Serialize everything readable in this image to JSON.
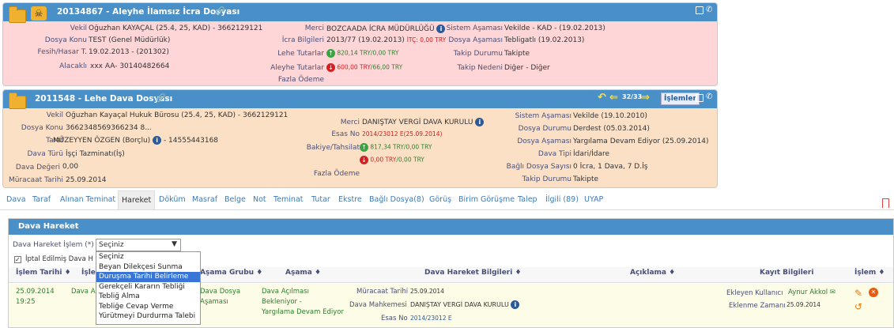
{
  "panel1": {
    "title": "20134867 - Aleyhe İlamsız İcra Dosyası",
    "vekil_l": "Vekil",
    "vekil_v": "Oğuzhan KAYAÇAL (25.4, 25, KAD) - 3662129121",
    "dkonu_l": "Dosya Konu",
    "dkonu_v": "TEST (Genel Müdürlük)",
    "fesih_l": "Fesih/Hasar T.",
    "fesih_v": "19.02.2013 - (201302)",
    "alacak_l": "Alacaklı",
    "alacak_v": "xxx AA- 30140482664",
    "merci_l": "Merci",
    "merci_v": "BOZCAADA İCRA MÜDÜRLÜĞÜ",
    "icra_l": "İcra Bilgileri",
    "icra_v": "2013/77 (19.02.2013)",
    "itc": "İTÇ: 0,00 TRY",
    "lehe_l": "Lehe Tutarlar",
    "lehe_v1": "820,14 TRY",
    "lehe_v2": "/0,00 TRY",
    "aleyhe_l": "Aleyhe Tutarlar",
    "aleyhe_v1": "600,00 TRY",
    "aleyhe_v2": "/66,00 TRY",
    "fazla_l": "Fazla Ödeme",
    "sistem_l": "Sistem Aşaması",
    "sistem_v": "Vekilde - KAD - (19.02.2013)",
    "dasama_l": "Dosya Aşaması",
    "dasama_v": "Tebligatlı (19.02.2013)",
    "tdurum_l": "Takip Durumu",
    "tdurum_v": "Takipte",
    "tneden_l": "Takip Nedeni",
    "tneden_v": "Diğer - Diğer"
  },
  "panel2": {
    "title": "2011548 - Lehe Dava Dosyası",
    "pager": "32/33",
    "islemler": "İşlemler",
    "vekil_l": "Vekil",
    "vekil_v": "Oğuzhan Kayaçal Hukuk Bürosu (25.4, 25, KAD) - 3662129121",
    "dkonu_l": "Dosya Konu",
    "dkonu_v": "3662348569366234 8...",
    "taraf_l": "Taraf",
    "taraf_v": "MÜZEYYEN ÖZGEN (Borçlu)",
    "taraf_v2": "- 14555443168",
    "dturu_l": "Dava Türü",
    "dturu_v": "İşçi Tazminatı(İş)",
    "ddeger_l": "Dava Değeri",
    "ddeger_v": "0,00",
    "mtarih_l": "Müracaat Tarihi",
    "mtarih_v": "25.09.2014",
    "merci_l": "Merci",
    "merci_v": "DANIŞTAY VERGİ DAVA KURULU",
    "esas_l": "Esas No",
    "esas_v": "2014/23012 E(25.09.2014)",
    "bakiye_l": "Bakiye/Tahsilat",
    "bakiye_v1": "817,34 TRY",
    "bakiye_v2": "/0,00 TRY",
    "bakiye_v3": "0,00 TRY",
    "bakiye_v4": "/0,00 TRY",
    "fazla_l": "Fazla Ödeme",
    "sistem_l": "Sistem Aşaması",
    "sistem_v": "Vekilde (19.10.2010)",
    "ddurum_l": "Dosya Durumu",
    "ddurum_v": "Derdest (05.03.2014)",
    "dasama_l": "Dosya Aşaması",
    "dasama_v": "Yargılama Devam Ediyor (25.09.2014)",
    "dtipi_l": "Dava Tipi",
    "dtipi_v": "İdari/İdare",
    "bagli_l": "Bağlı Dosya Sayısı",
    "bagli_v": "0 İcra, 1 Dava, 7 D.İş",
    "tdurum_l": "Takip Durumu",
    "tdurum_v": "Takipte"
  },
  "tabs": [
    "Dava",
    "Taraf",
    "Alınan Teminat",
    "Hareket",
    "Döküm",
    "Masraf",
    "Belge",
    "Not",
    "Teminat",
    "Tutar",
    "Ekstre",
    "Bağlı Dosya(8)",
    "Görüş",
    "Birim Görüşme",
    "Talep",
    "İlgili (89)",
    "UYAP"
  ],
  "section": {
    "title": "Dava Hareket",
    "islem_label": "Dava Hareket İşlem (*)",
    "select_value": "Seçiniz",
    "checkbox_label": "İptal Edilmiş Dava H",
    "options": [
      "Seçiniz",
      "Beyan Dilekçesi Sunma",
      "Duruşma Tarihi Belirleme",
      "Gerekçeli Kararın Tebliği",
      "Tebliğ Alma",
      "Tebliğe Cevap Verme",
      "Yürütmeyi Durdurma Talebi"
    ],
    "columns": {
      "tarih": "İşlem Tarihi ♦",
      "islem": "İşle",
      "grup": "Aşama Grubu ♦",
      "asama": "Aşama ♦",
      "bilgi": "Dava Hareket Bilgileri ♦",
      "aciklama": "Açıklama ♦",
      "kayit": "Kayıt Bilgileri",
      "islem2": "İşlem ♦"
    },
    "row": {
      "tarih": "25.09.2014",
      "saat": "19:25",
      "islem": "Dava A",
      "grup1": "Dava Dosya",
      "grup2": "Aşaması",
      "asama1": "Dava Açılması",
      "asama2": "Bekleniyor -",
      "asama3": "Yargılama Devam Ediyor",
      "mtarih_l": "Müracaat Tarihi",
      "mtarih_v": "25.09.2014",
      "mahkeme_l": "Dava Mahkemesi",
      "mahkeme_v": "DANIŞTAY VERGİ DAVA KURULU",
      "esas_l": "Esas No",
      "esas_v": "2014/23012 E",
      "ekleyen_l": "Ekleyen Kullanıcı",
      "ekleyen_v": "Aynur Akkol",
      "ezaman_l": "Eklenme Zamanı",
      "ezaman_v": "25.09.2014"
    }
  },
  "colors": {
    "header": "#4a90c8",
    "panel1_bg": "#ffd6d8",
    "panel2_bg": "#fbe0c6",
    "label": "#4a4f75"
  }
}
